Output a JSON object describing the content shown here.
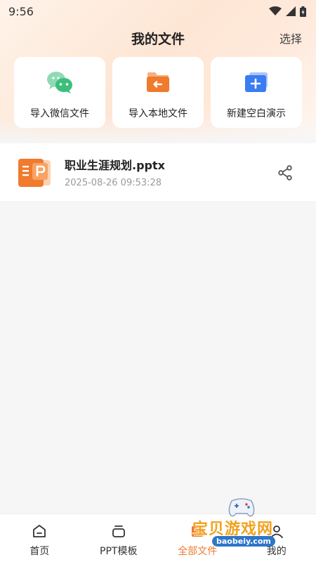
{
  "status_bar": {
    "time": "9:56"
  },
  "header": {
    "title": "我的文件",
    "select_label": "选择"
  },
  "actions": [
    {
      "label": "导入微信文件",
      "icon": "wechat-icon"
    },
    {
      "label": "导入本地文件",
      "icon": "folder-import-icon"
    },
    {
      "label": "新建空白演示",
      "icon": "new-presentation-icon"
    }
  ],
  "files": [
    {
      "name": "职业生涯规划.pptx",
      "date": "2025-08-26 09:53:28",
      "icon": "pptx-file-icon"
    }
  ],
  "bottom_nav": {
    "items": [
      {
        "label": "首页",
        "icon": "home-icon"
      },
      {
        "label": "PPT模板",
        "icon": "template-icon"
      },
      {
        "label": "全部文件",
        "icon": "files-icon"
      },
      {
        "label": "我的",
        "icon": "profile-icon"
      }
    ],
    "active_index": 2
  },
  "watermark": {
    "text_cn": "宝贝游戏网",
    "text_en": "baobeiy.com"
  },
  "colors": {
    "accent": "#f07a2e",
    "wechat": "#3dbf7c",
    "folder": "#f07a2e",
    "new_doc": "#3a7cf2"
  }
}
